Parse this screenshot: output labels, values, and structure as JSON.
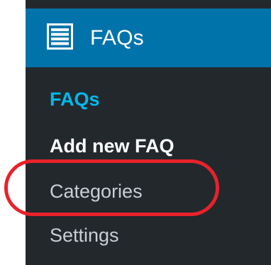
{
  "menu": {
    "header": {
      "icon": "list-icon",
      "title": "FAQs"
    },
    "items": [
      {
        "label": "FAQs",
        "state": "current"
      },
      {
        "label": "Add new FAQ",
        "state": "default"
      },
      {
        "label": "Categories",
        "state": "highlighted"
      },
      {
        "label": "Settings",
        "state": "default"
      }
    ]
  },
  "colors": {
    "sidebar_bg": "#23282d",
    "header_bg": "#0073aa",
    "current_item": "#00b9eb",
    "highlight_ring": "#e8222a"
  }
}
